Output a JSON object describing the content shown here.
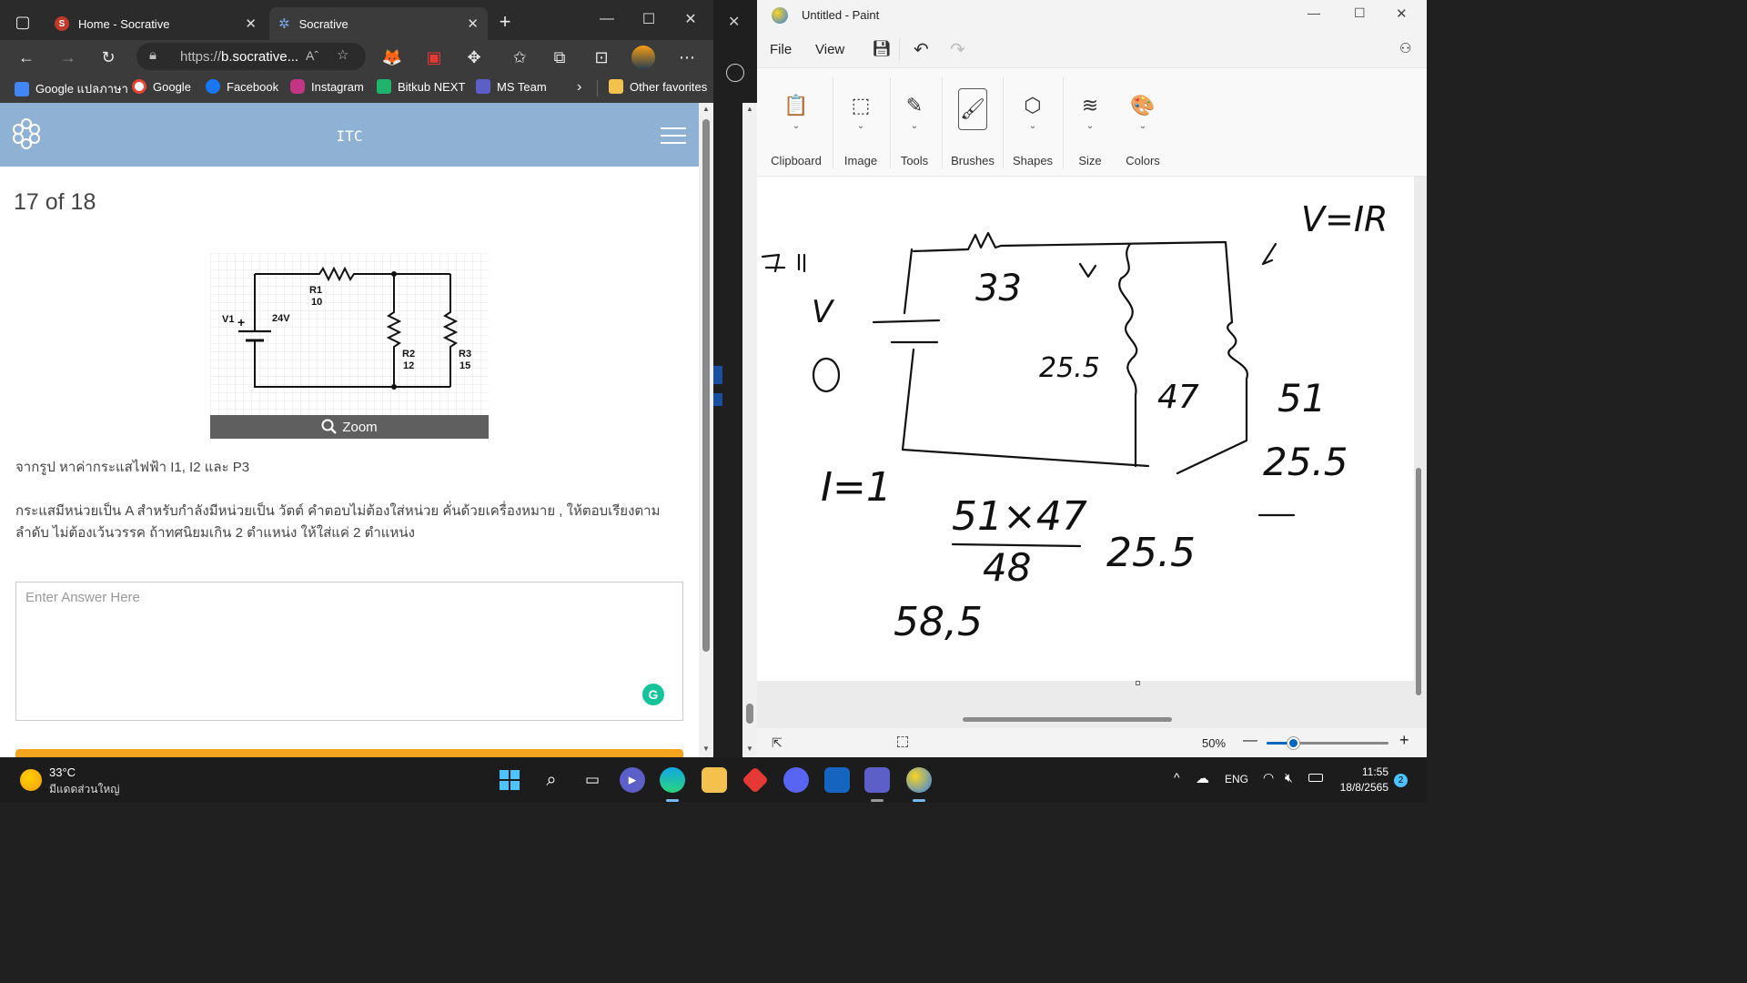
{
  "edge": {
    "tabs": [
      {
        "title": "Home - Socrative",
        "favicon": "S"
      },
      {
        "title": "Socrative"
      }
    ],
    "address": {
      "prefix": "https://",
      "host": "b.socrative..."
    },
    "read_aloud": "Aˆ",
    "favorites": [
      {
        "label": "Google แปลภาษา",
        "color": "#4285f4"
      },
      {
        "label": "Google",
        "color": "#ea4335"
      },
      {
        "label": "Facebook",
        "color": "#1877f2"
      },
      {
        "label": "Instagram",
        "color": "#c13584"
      },
      {
        "label": "Bitkub NEXT",
        "color": "#1fb36b"
      },
      {
        "label": "MS Team",
        "color": "#5b5fc7"
      }
    ],
    "other_favorites": "Other favorites"
  },
  "socrative": {
    "header_title": "ITC",
    "question_count": "17 of 18",
    "circuit": {
      "r1_name": "R1",
      "r1_value": "10",
      "source_name": "V1",
      "source_value": "24V",
      "plus": "+",
      "r2_name": "R2",
      "r2_value": "12",
      "r3_name": "R3",
      "r3_value": "15"
    },
    "zoom_label": "Zoom",
    "question_text": "จากรูป หาค่ากระแสไฟฟ้า I1, I2 และ P3",
    "instruction_text": "กระแสมีหน่วยเป็น A สำหรับกำลังมีหน่วยเป็น วัตต์ คำตอบไม่ต้องใส่หน่วย คั่นด้วยเครื่องหมาย , ให้ตอบเรียงตามลำดับ ไม่ต้องเว้นวรรค ถ้าทศนิยมเกิน 2 ตำแหน่ง ให้ใส่แค่ 2 ตำแหน่ง",
    "answer_placeholder": "Enter Answer Here",
    "grammarly_letter": "G"
  },
  "paint": {
    "title": "Untitled - Paint",
    "menu": {
      "file": "File",
      "view": "View"
    },
    "ribbon": [
      {
        "label": "Clipboard",
        "icon": "clipboard-icon",
        "glyph": "📋"
      },
      {
        "label": "Image",
        "icon": "select-icon",
        "glyph": "⬚"
      },
      {
        "label": "Tools",
        "icon": "tools-icon",
        "glyph": "✎"
      },
      {
        "label": "Brushes",
        "icon": "brush-icon",
        "glyph": "🖌"
      },
      {
        "label": "Shapes",
        "icon": "shapes-icon",
        "glyph": "⬡"
      },
      {
        "label": "Size",
        "icon": "size-icon",
        "glyph": "≋"
      },
      {
        "label": "Colors",
        "icon": "palette-icon",
        "glyph": "🎨"
      }
    ],
    "zoom_level": "50%",
    "zoom_fraction": 0.22,
    "sketch_labels": {
      "v_ir": "V=IR",
      "r33": "33",
      "v": "V",
      "r47": "47",
      "r255": "25.5",
      "r51": "51",
      "r255b": "25.5",
      "i_eq": "I=1",
      "num": "51×47",
      "den": "48",
      "res": "25.5",
      "total": "58,5"
    }
  },
  "taskbar": {
    "temperature": "33°C",
    "weather": "มีแดดส่วนใหญ่",
    "language": "ENG",
    "time": "11:55",
    "date": "18/8/2565",
    "notification_count": "2"
  }
}
